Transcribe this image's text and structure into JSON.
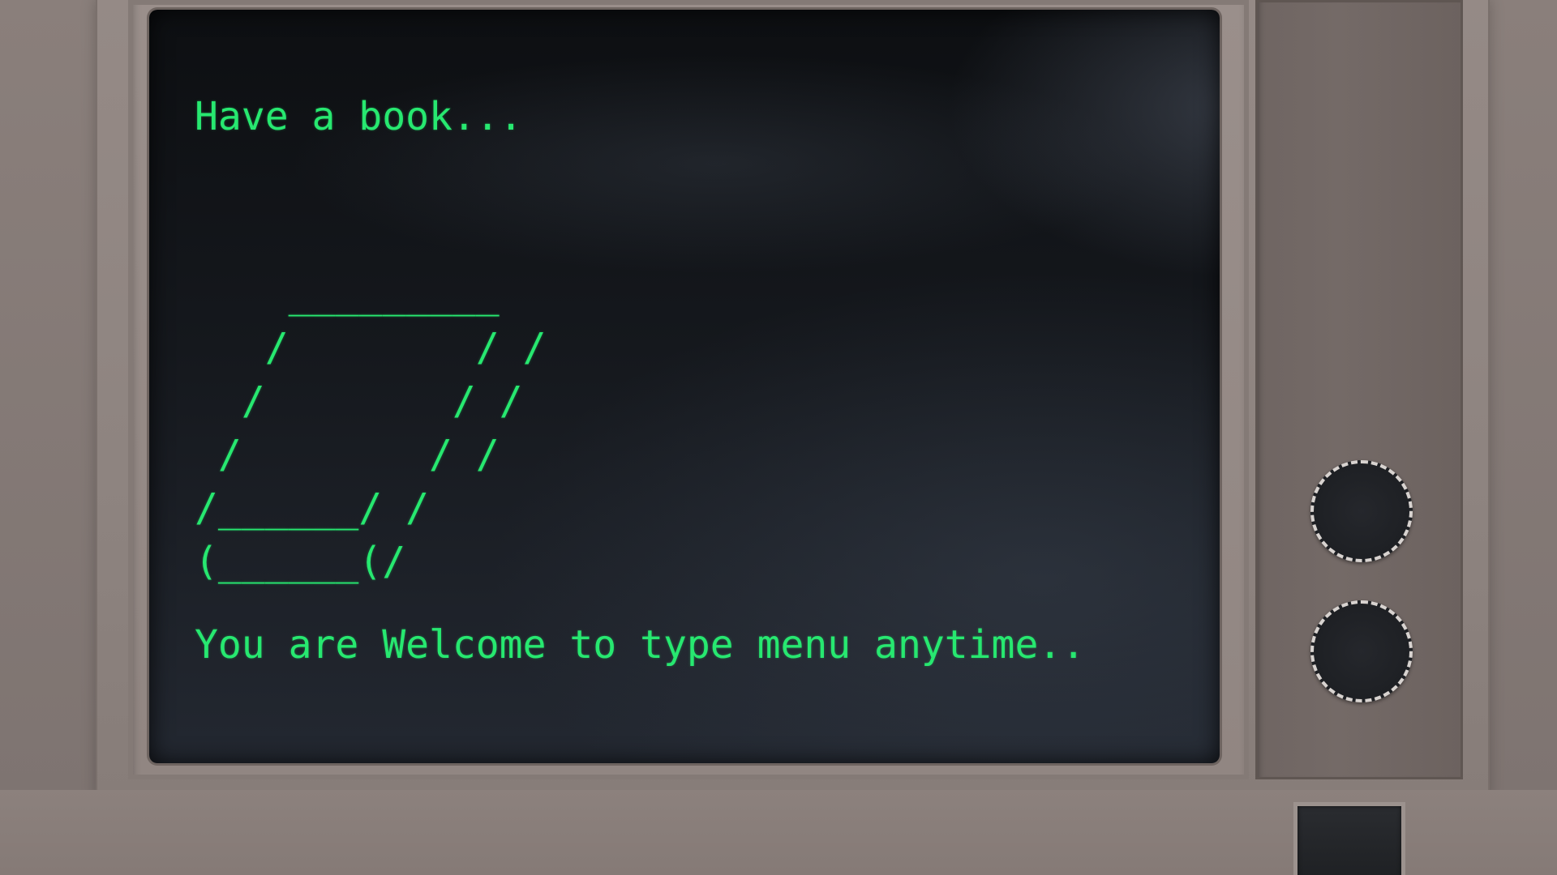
{
  "terminal": {
    "line1": "Have a book...",
    "ascii_book": "    _________\n   /        / /\n  /        / /\n /        / /\n/______/ /\n(______(/",
    "line2": "You are Welcome to type menu anytime.."
  },
  "colors": {
    "text": "#27e870",
    "screen_bg": "#14171c",
    "casing": "#8e8480"
  },
  "controls": {
    "knob_icons": [
      "dial-icon",
      "dial-icon"
    ]
  }
}
